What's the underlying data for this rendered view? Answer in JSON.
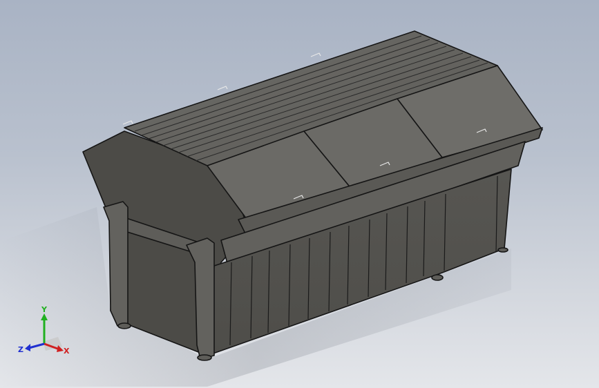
{
  "viewport": {
    "background_top": "#a9b3c4",
    "background_bottom": "#e4e6ea",
    "model_fill": "#5b5a56",
    "model_edge": "#1a1a1a"
  },
  "triad": {
    "x_label": "X",
    "y_label": "Y",
    "z_label": "Z",
    "x_color": "#d02020",
    "y_color": "#20b020",
    "z_color": "#2030d0"
  }
}
